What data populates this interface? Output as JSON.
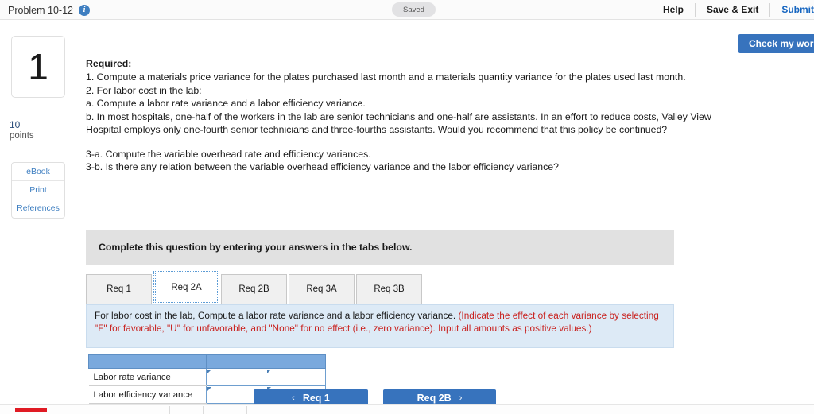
{
  "header": {
    "problem_title": "Problem 10-12",
    "info_icon": "info-icon",
    "saved_badge": "Saved",
    "help_label": "Help",
    "save_exit_label": "Save & Exit",
    "submit_label": "Submit",
    "check_my_work_label": "Check my work"
  },
  "sidebar": {
    "question_number": "1",
    "points_value": "10",
    "points_label": "points",
    "tools": [
      {
        "label": "eBook"
      },
      {
        "label": "Print"
      },
      {
        "label": "References"
      }
    ]
  },
  "required": {
    "heading": "Required:",
    "lines": [
      "1. Compute a materials price variance for the plates purchased last month and a materials quantity variance for the plates used last month.",
      "2. For labor cost in the lab:",
      "a. Compute a labor rate variance and a labor efficiency variance.",
      "b. In most hospitals, one-half of the workers in the lab are senior technicians and one-half are assistants. In an effort to reduce costs, Valley View Hospital employs only one-fourth senior technicians and three-fourths assistants. Would you recommend that this policy be continued?"
    ],
    "lines2": [
      "3-a. Compute the variable overhead rate and efficiency variances.",
      "3-b. Is there any relation between the variable overhead efficiency variance and the labor efficiency variance?"
    ]
  },
  "banner": {
    "text": "Complete this question by entering your answers in the tabs below."
  },
  "tabs": {
    "items": [
      {
        "label": "Req 1",
        "active": false
      },
      {
        "label": "Req 2A",
        "active": true
      },
      {
        "label": "Req 2B",
        "active": false
      },
      {
        "label": "Req 3A",
        "active": false
      },
      {
        "label": "Req 3B",
        "active": false
      }
    ]
  },
  "instruction": {
    "black_text": "For labor cost in the lab, Compute a labor rate variance and a labor efficiency variance.",
    "red_text": "(Indicate the effect of each variance by selecting \"F\" for favorable, \"U\" for unfavorable, and \"None\" for no effect (i.e., zero variance). Input all amounts as positive values.)"
  },
  "answer_table": {
    "header_cells": [
      "",
      "",
      ""
    ],
    "rows": [
      {
        "label": "Labor rate variance",
        "amount": "",
        "effect": ""
      },
      {
        "label": "Labor efficiency variance",
        "amount": "",
        "effect": ""
      }
    ]
  },
  "footer_nav": {
    "prev_chevron": "‹",
    "prev_label": "Req 1",
    "next_label": "Req 2B",
    "next_chevron": "›"
  },
  "colors": {
    "accent_blue": "#3773bd",
    "table_header_blue": "#7aa9dd",
    "panel_blue": "#ddeaf6",
    "red_text": "#c9221f",
    "link_blue": "#1565c0",
    "progress_red": "#e01b24"
  }
}
